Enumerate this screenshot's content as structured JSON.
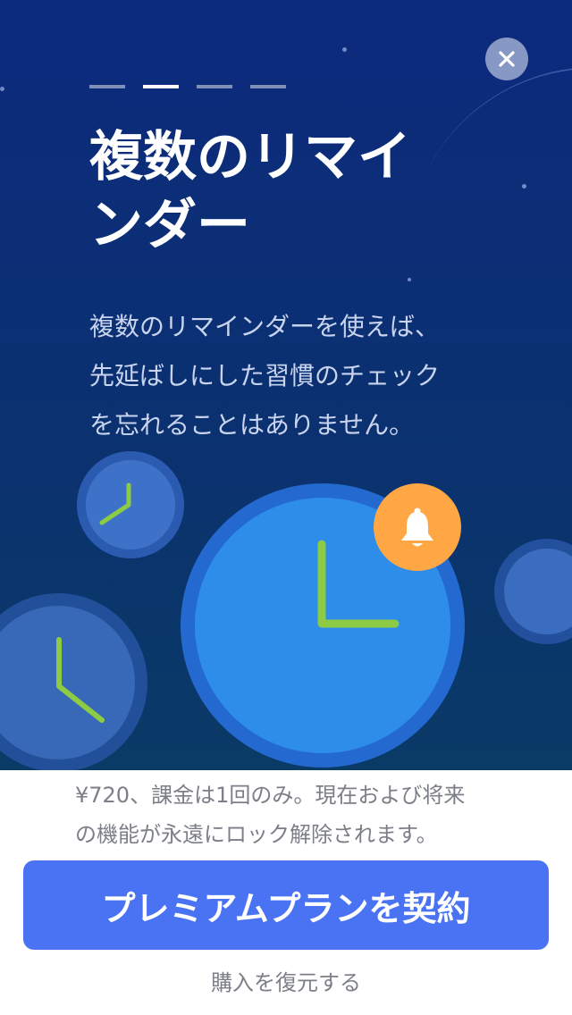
{
  "close_icon": "close-icon",
  "pager": {
    "count": 4,
    "active_index": 1
  },
  "title_lines": [
    "複数のリマイ",
    "ンダー"
  ],
  "description_lines": [
    "複数のリマインダーを使えば、",
    "先延ばしにした習慣のチェック",
    "を忘れることはありません。"
  ],
  "illustration": {
    "bell_icon": "bell-icon",
    "clock_icons": [
      "clock-icon"
    ]
  },
  "footer": {
    "price_lines": [
      "¥720、課金は1回のみ。現在および将来",
      "の機能が永遠にロック解除されます。"
    ],
    "subscribe_label": "プレミアムプランを契約",
    "restore_label": "購入を復元する"
  },
  "colors": {
    "accent": "#4A73F4",
    "bell_badge": "#FFA645",
    "clock_hand": "#8DCB44"
  }
}
